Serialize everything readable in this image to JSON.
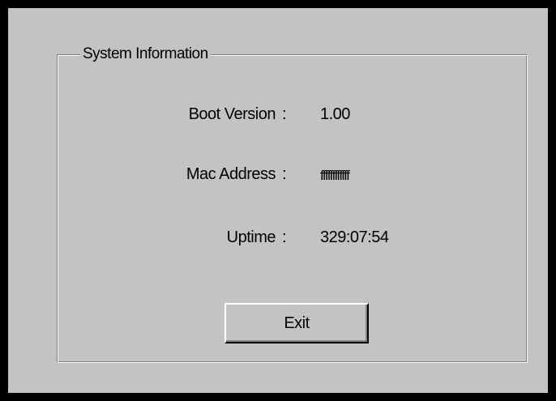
{
  "group": {
    "title": "System Information"
  },
  "fields": [
    {
      "label": "Boot Version",
      "separator": ":",
      "value": "1.00"
    },
    {
      "label": "Mac Address",
      "separator": ":",
      "value": "ffffffffffff"
    },
    {
      "label": "Uptime",
      "separator": ":",
      "value": "329:07:54"
    }
  ],
  "buttons": {
    "exit_label": "Exit"
  },
  "colors": {
    "frame": "#000000",
    "dialog_background": "#c3c3c3",
    "shadow": "#808080",
    "highlight": "#ffffff"
  }
}
